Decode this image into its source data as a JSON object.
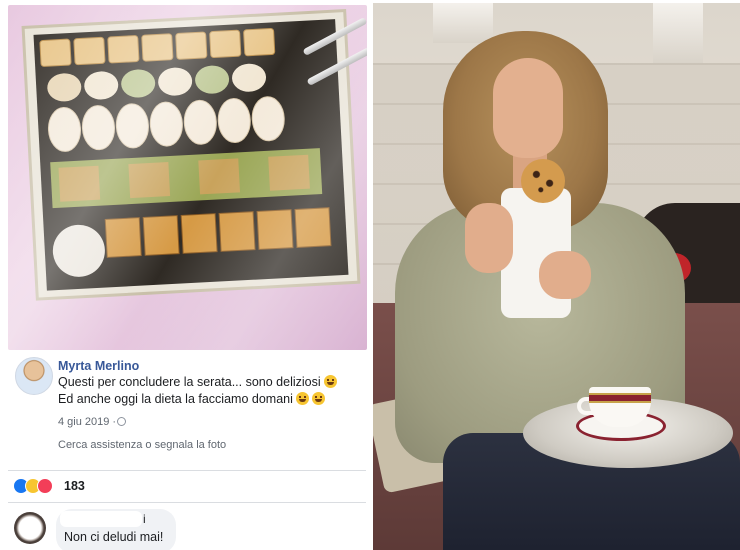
{
  "post": {
    "author": "Myrta Merlino",
    "line1": "Questi per concludere la serata... sono deliziosi",
    "line2": "Ed anche oggi la dieta la facciamo domani",
    "date": "4 giu 2019 ·",
    "report_link": "Cerca assistenza o segnala la foto",
    "reactions": {
      "count": "183",
      "icons": [
        "like-icon",
        "haha-icon",
        "love-icon"
      ]
    }
  },
  "comment": {
    "author_visible": "i",
    "text": "Non ci deludi mai!"
  },
  "colors": {
    "author_link": "#385898",
    "like": "#1877f2",
    "love": "#f33e58",
    "haha": "#f7c531",
    "bubble": "#f0f2f5"
  }
}
